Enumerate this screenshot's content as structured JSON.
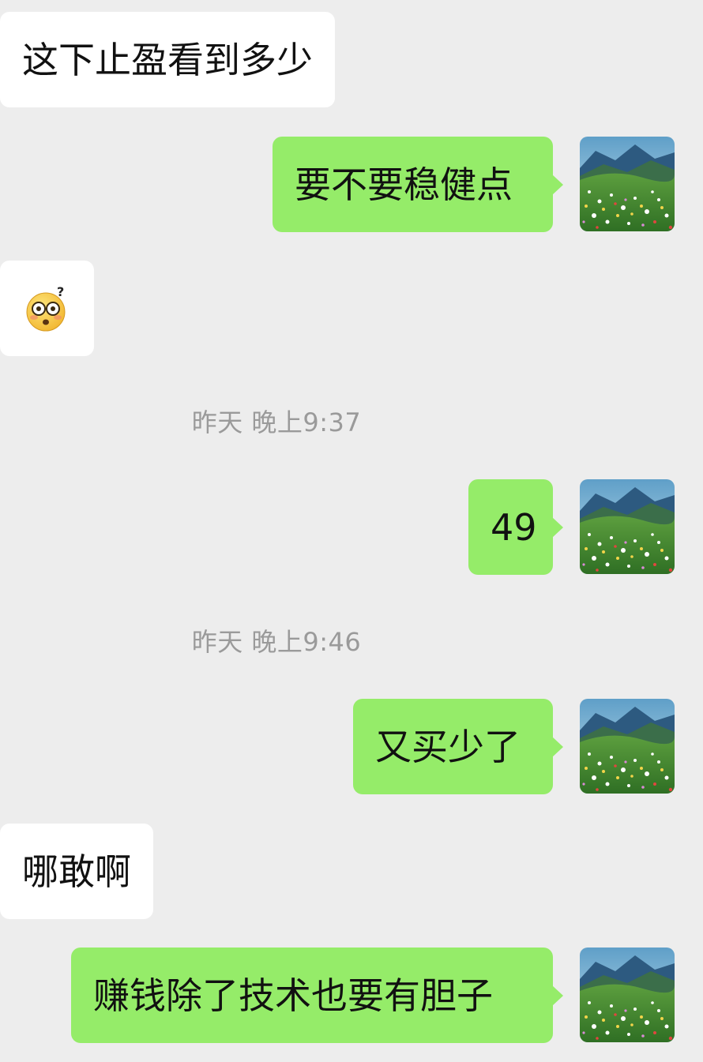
{
  "messages": [
    {
      "side": "in",
      "text": "这下止盈看到多少"
    },
    {
      "side": "out",
      "text": "要不要稳健点"
    },
    {
      "side": "in",
      "sticker": "dizzy-question-emoji"
    },
    {
      "timestamp": "昨天 晚上9:37"
    },
    {
      "side": "out",
      "text": "49"
    },
    {
      "timestamp": "昨天 晚上9:46"
    },
    {
      "side": "out",
      "text": "又买少了"
    },
    {
      "side": "in",
      "text": "哪敢啊"
    },
    {
      "side": "out",
      "text": "赚钱除了技术也要有胆子"
    }
  ],
  "colors": {
    "background": "#ededed",
    "incoming_bubble": "#ffffff",
    "outgoing_bubble": "#95ec69",
    "timestamp_text": "#9a9a9a"
  },
  "avatar": {
    "icon": "landscape-flower-field-avatar"
  }
}
